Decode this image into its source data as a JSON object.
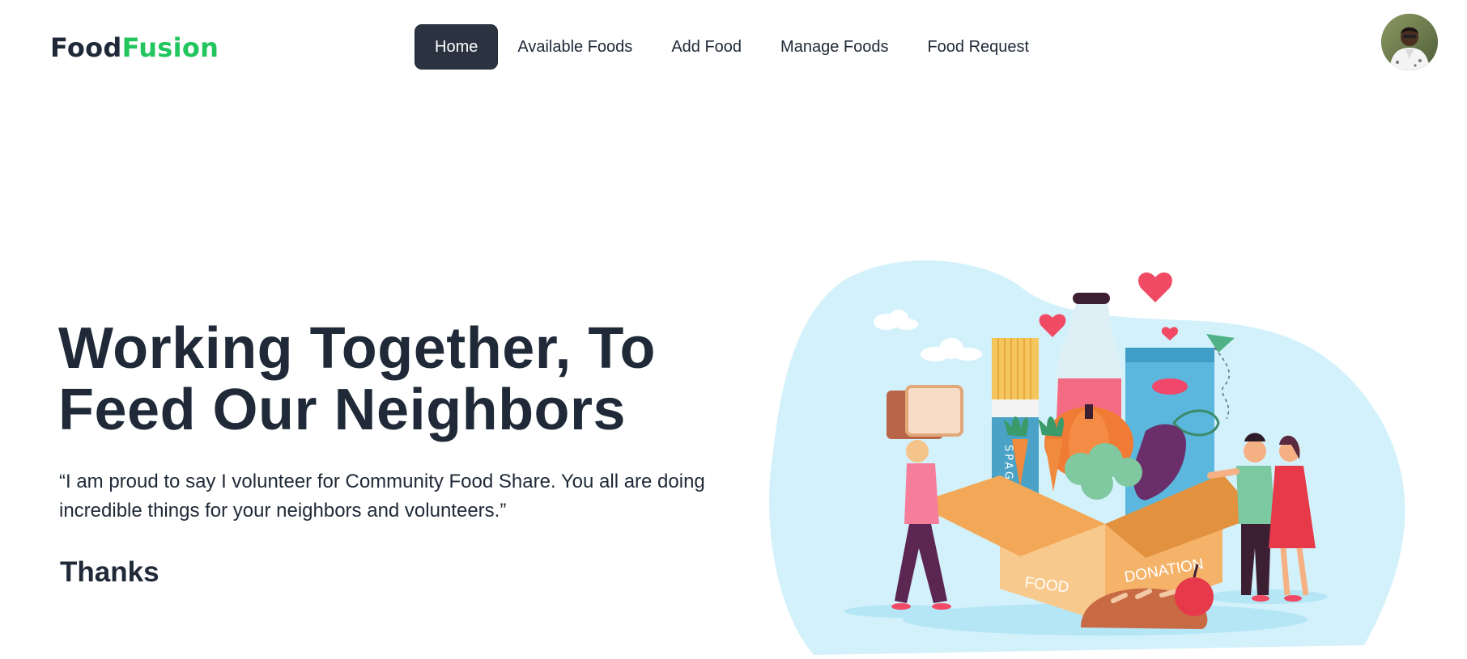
{
  "brand": {
    "part1": "Food",
    "part2": "Fusion"
  },
  "nav": {
    "items": [
      {
        "label": "Home",
        "active": true
      },
      {
        "label": "Available Foods",
        "active": false
      },
      {
        "label": "Add Food",
        "active": false
      },
      {
        "label": "Manage Foods",
        "active": false
      },
      {
        "label": "Food Request",
        "active": false
      }
    ]
  },
  "user": {
    "avatar_icon": "user-avatar"
  },
  "hero": {
    "title_line1": "Working Together, To",
    "title_line2": "Feed Our Neighbors",
    "quote": "“I am proud to say I volunteer for Community Food Share. You all are doing incredible things for your neighbors and volunteers.”",
    "signature": "Thanks"
  },
  "illustration": {
    "box_label_left": "FOOD",
    "box_label_right": "DONATION",
    "pack_label": "SPAG"
  },
  "colors": {
    "accent_green": "#22c55e",
    "dark": "#1f2937",
    "nav_active_bg": "#2b3340",
    "blob": "#d3f1fb"
  }
}
